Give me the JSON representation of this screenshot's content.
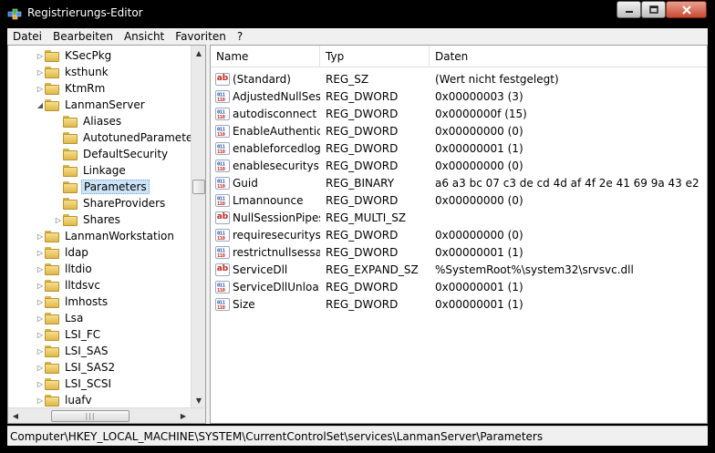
{
  "window": {
    "title": "Registrierungs-Editor",
    "controls": {
      "minimize": "▁",
      "maximize": "□",
      "close": "✕"
    }
  },
  "menu": [
    "Datei",
    "Bearbeiten",
    "Ansicht",
    "Favoriten",
    "?"
  ],
  "tree": {
    "items": [
      {
        "label": "KSecPkg",
        "level": 3,
        "expander": "▷"
      },
      {
        "label": "ksthunk",
        "level": 3,
        "expander": "▷"
      },
      {
        "label": "KtmRm",
        "level": 3,
        "expander": "▷"
      },
      {
        "label": "LanmanServer",
        "level": 3,
        "expander": "◢"
      },
      {
        "label": "Aliases",
        "level": 4,
        "expander": ""
      },
      {
        "label": "AutotunedParameters",
        "level": 4,
        "expander": ""
      },
      {
        "label": "DefaultSecurity",
        "level": 4,
        "expander": ""
      },
      {
        "label": "Linkage",
        "level": 4,
        "expander": ""
      },
      {
        "label": "Parameters",
        "level": 4,
        "expander": "",
        "selected": true
      },
      {
        "label": "ShareProviders",
        "level": 4,
        "expander": ""
      },
      {
        "label": "Shares",
        "level": 4,
        "expander": "▷"
      },
      {
        "label": "LanmanWorkstation",
        "level": 3,
        "expander": "▷"
      },
      {
        "label": "ldap",
        "level": 3,
        "expander": "▷"
      },
      {
        "label": "lltdio",
        "level": 3,
        "expander": "▷"
      },
      {
        "label": "lltdsvc",
        "level": 3,
        "expander": "▷"
      },
      {
        "label": "lmhosts",
        "level": 3,
        "expander": "▷"
      },
      {
        "label": "Lsa",
        "level": 3,
        "expander": "▷"
      },
      {
        "label": "LSI_FC",
        "level": 3,
        "expander": "▷"
      },
      {
        "label": "LSI_SAS",
        "level": 3,
        "expander": "▷"
      },
      {
        "label": "LSI_SAS2",
        "level": 3,
        "expander": "▷"
      },
      {
        "label": "LSI_SCSI",
        "level": 3,
        "expander": "▷"
      },
      {
        "label": "luafv",
        "level": 3,
        "expander": "▷"
      }
    ],
    "scroll_up": "▲",
    "scroll_down": "▼",
    "scroll_left": "◀",
    "scroll_right": "▶",
    "hthumb_grip": "|||"
  },
  "list": {
    "columns": {
      "name": "Name",
      "type": "Typ",
      "data": "Daten"
    },
    "rows": [
      {
        "icon": "string-value-icon",
        "glyph": "ab",
        "name": "(Standard)",
        "type": "REG_SZ",
        "data": "(Wert nicht festgelegt)"
      },
      {
        "icon": "binary-value-icon",
        "glyph": "011\n110",
        "name": "AdjustedNullSes...",
        "type": "REG_DWORD",
        "data": "0x00000003 (3)"
      },
      {
        "icon": "binary-value-icon",
        "glyph": "011\n110",
        "name": "autodisconnect",
        "type": "REG_DWORD",
        "data": "0x0000000f (15)"
      },
      {
        "icon": "binary-value-icon",
        "glyph": "011\n110",
        "name": "EnableAuthentic...",
        "type": "REG_DWORD",
        "data": "0x00000000 (0)"
      },
      {
        "icon": "binary-value-icon",
        "glyph": "011\n110",
        "name": "enableforcedlog...",
        "type": "REG_DWORD",
        "data": "0x00000001 (1)"
      },
      {
        "icon": "binary-value-icon",
        "glyph": "011\n110",
        "name": "enablesecuritysi...",
        "type": "REG_DWORD",
        "data": "0x00000000 (0)"
      },
      {
        "icon": "binary-value-icon",
        "glyph": "011\n110",
        "name": "Guid",
        "type": "REG_BINARY",
        "data": "a6 a3 bc 07 c3 de cd 4d af 4f 2e 41 69 9a 43 e2"
      },
      {
        "icon": "binary-value-icon",
        "glyph": "011\n110",
        "name": "Lmannounce",
        "type": "REG_DWORD",
        "data": "0x00000000 (0)"
      },
      {
        "icon": "string-value-icon",
        "glyph": "ab",
        "name": "NullSessionPipes",
        "type": "REG_MULTI_SZ",
        "data": ""
      },
      {
        "icon": "binary-value-icon",
        "glyph": "011\n110",
        "name": "requiresecuritysi...",
        "type": "REG_DWORD",
        "data": "0x00000000 (0)"
      },
      {
        "icon": "binary-value-icon",
        "glyph": "011\n110",
        "name": "restrictnullsessa...",
        "type": "REG_DWORD",
        "data": "0x00000001 (1)"
      },
      {
        "icon": "string-value-icon",
        "glyph": "ab",
        "name": "ServiceDll",
        "type": "REG_EXPAND_SZ",
        "data": "%SystemRoot%\\system32\\srvsvc.dll"
      },
      {
        "icon": "binary-value-icon",
        "glyph": "011\n110",
        "name": "ServiceDllUnloa...",
        "type": "REG_DWORD",
        "data": "0x00000001 (1)"
      },
      {
        "icon": "binary-value-icon",
        "glyph": "011\n110",
        "name": "Size",
        "type": "REG_DWORD",
        "data": "0x00000001 (1)"
      }
    ]
  },
  "status": {
    "path": "Computer\\HKEY_LOCAL_MACHINE\\SYSTEM\\CurrentControlSet\\services\\LanmanServer\\Parameters"
  },
  "colors": {
    "selection": "#cce4f7",
    "string_icon": "#c0281d",
    "binary_icon": "#1c4fae"
  }
}
